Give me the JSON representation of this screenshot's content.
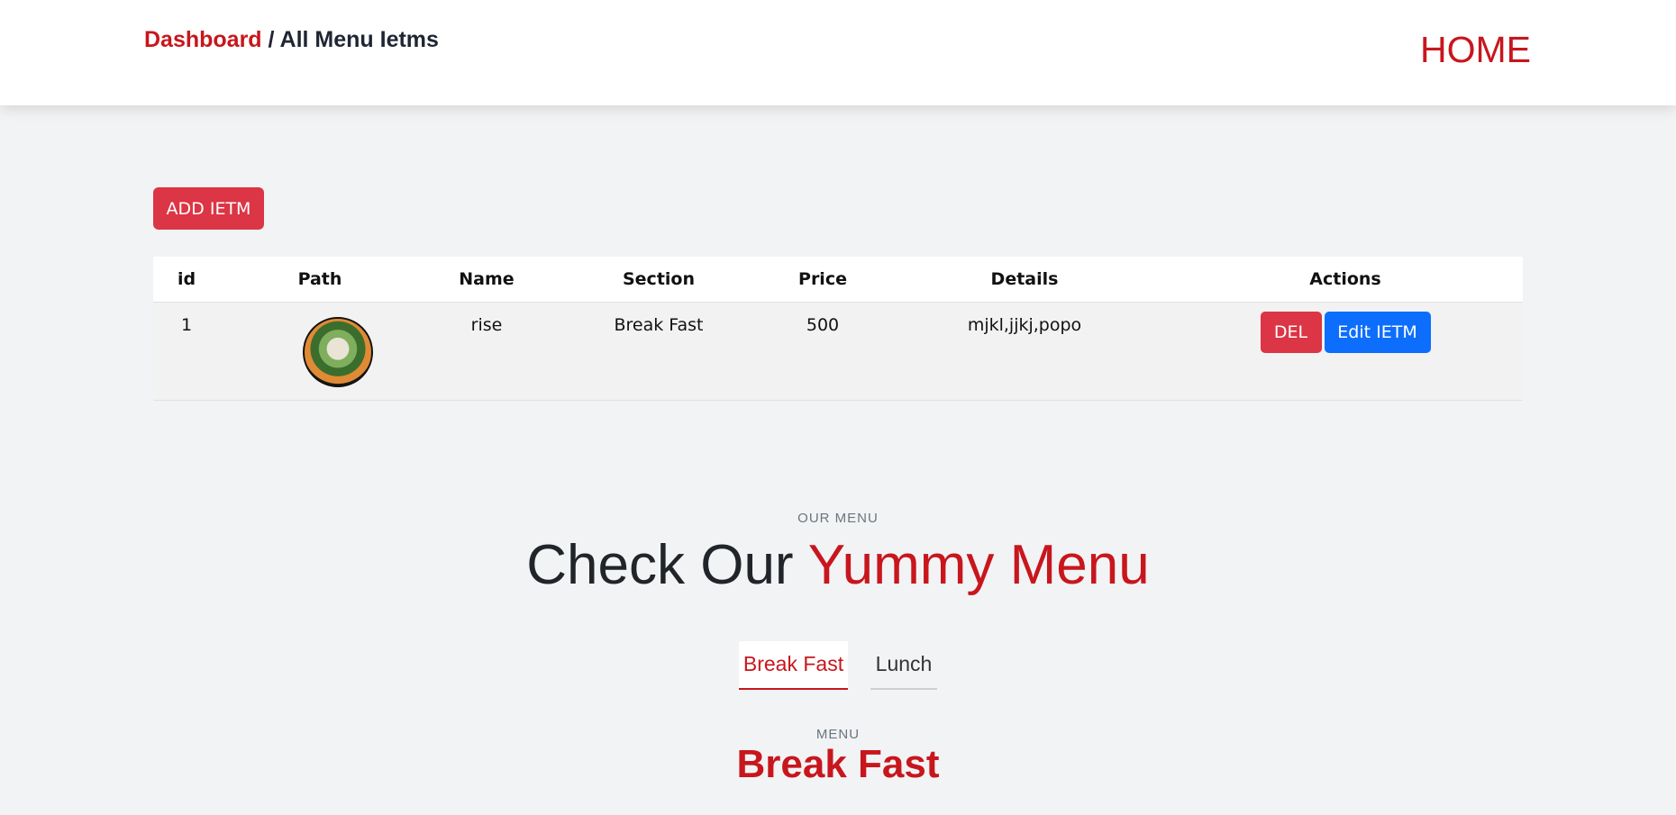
{
  "header": {
    "breadcrumb_link": "Dashboard",
    "breadcrumb_separator": " / ",
    "breadcrumb_current": "All Menu Ietms",
    "home_label": "HOME"
  },
  "toolbar": {
    "add_label": "ADD IETM"
  },
  "table": {
    "columns": [
      "id",
      "Path",
      "Name",
      "Section",
      "Price",
      "Details",
      "Actions"
    ],
    "rows": [
      {
        "id": "1",
        "name": "rise",
        "section": "Break Fast",
        "price": "500",
        "details": "mjkl,jjkj,popo",
        "del_label": "DEL",
        "edit_label": "Edit IETM"
      }
    ]
  },
  "menu": {
    "eyebrow": "OUR MENU",
    "title_plain": "Check Our ",
    "title_accent": "Yummy Menu",
    "tabs": [
      "Break Fast",
      "Lunch"
    ],
    "active_tab": "Break Fast",
    "section_eyebrow": "MENU",
    "section_title": "Break Fast"
  },
  "colors": {
    "accent": "#c8161d",
    "danger": "#dc3545",
    "primary": "#0d6efd"
  },
  "icons": {
    "thumbnail": "food-dish-image"
  }
}
